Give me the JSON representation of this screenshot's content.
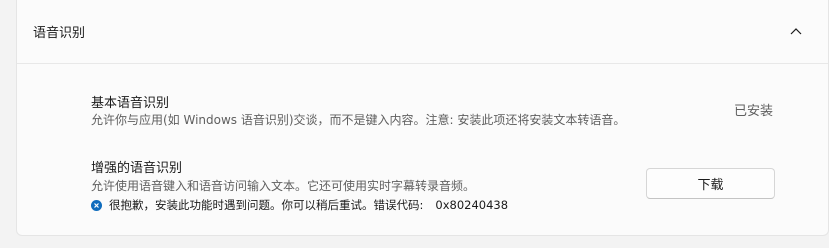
{
  "section": {
    "title": "语音识别"
  },
  "items": [
    {
      "title": "基本语音识别",
      "description": "允许你与应用(如 Windows 语音识别)交谈，而不是键入内容。注意: 安装此项还将安装文本转语音。",
      "status": "已安装"
    },
    {
      "title": "增强的语音识别",
      "description": "允许使用语音键入和语音访问输入文本。它还可使用实时字幕转录音频。",
      "error_message": "很抱歉，安装此功能时遇到问题。你可以稍后重试。错误代码:",
      "error_code": "0x80240438",
      "button_label": "下载"
    }
  ],
  "icons": {
    "collapse": "chevron-up-icon",
    "error": "error-x-icon"
  },
  "colors": {
    "error": "#0f6cbd"
  }
}
